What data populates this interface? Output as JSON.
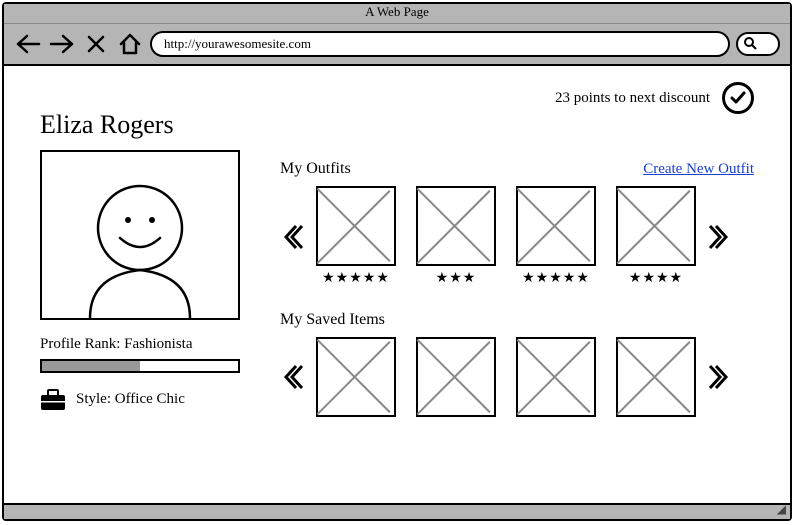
{
  "window": {
    "title": "A Web Page",
    "url": "http://yourawesomesite.com"
  },
  "points": {
    "text": "23 points to next discount"
  },
  "profile": {
    "name": "Eliza Rogers",
    "rank_label": "Profile Rank: Fashionista",
    "rank_progress_pct": 50,
    "style_label": "Style: Office Chic"
  },
  "sections": {
    "outfits": {
      "title": "My Outfits",
      "create_link": "Create New Outfit",
      "items": [
        {
          "rating": 5
        },
        {
          "rating": 3
        },
        {
          "rating": 5
        },
        {
          "rating": 4
        }
      ]
    },
    "saved": {
      "title": "My Saved Items",
      "items": [
        {},
        {},
        {},
        {}
      ]
    }
  }
}
